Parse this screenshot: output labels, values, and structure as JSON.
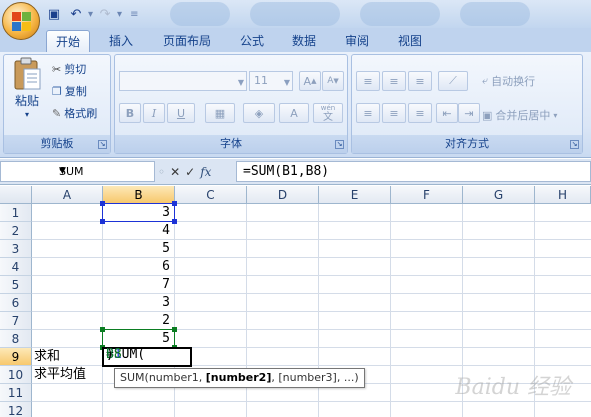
{
  "tabs": [
    "开始",
    "插入",
    "页面布局",
    "公式",
    "数据",
    "审阅",
    "视图"
  ],
  "active_tab": "开始",
  "clipboard": {
    "paste": "粘贴",
    "cut": "剪切",
    "copy": "复制",
    "format_painter": "格式刷",
    "label": "剪贴板"
  },
  "font": {
    "size": "11",
    "bold": "B",
    "italic": "I",
    "underline": "U",
    "grow": "A",
    "shrink": "A",
    "color": "A",
    "wen": "wén",
    "phonetic": "文",
    "label": "字体"
  },
  "alignment": {
    "wrap": "自动换行",
    "merge": "合并后居中",
    "label": "对齐方式"
  },
  "formula_bar": {
    "name_box": "SUM",
    "fx": "fx",
    "formula": "=SUM(B1,B8)"
  },
  "columns": [
    "A",
    "B",
    "C",
    "D",
    "E",
    "F",
    "G",
    "H"
  ],
  "rows": [
    "1",
    "2",
    "3",
    "4",
    "5",
    "6",
    "7",
    "8",
    "9",
    "10",
    "11",
    "12"
  ],
  "cells": {
    "B": [
      "3",
      "4",
      "5",
      "6",
      "7",
      "3",
      "2",
      "5"
    ],
    "A9": "求和",
    "A10": "求平均值"
  },
  "active_cell": {
    "prefix": "=SUM(",
    "ref1": "B1",
    "comma": ",",
    "ref2": "B8",
    "suffix": ")"
  },
  "tooltip": {
    "fn": "SUM(number1, ",
    "current": "[number2]",
    "rest": ", [number3], ...)"
  },
  "watermark": "Baidu 经验",
  "colors": {
    "ref_blue": "#1d33d6",
    "ref_green": "#0b7d22",
    "selected_header": "#f7c86d"
  }
}
